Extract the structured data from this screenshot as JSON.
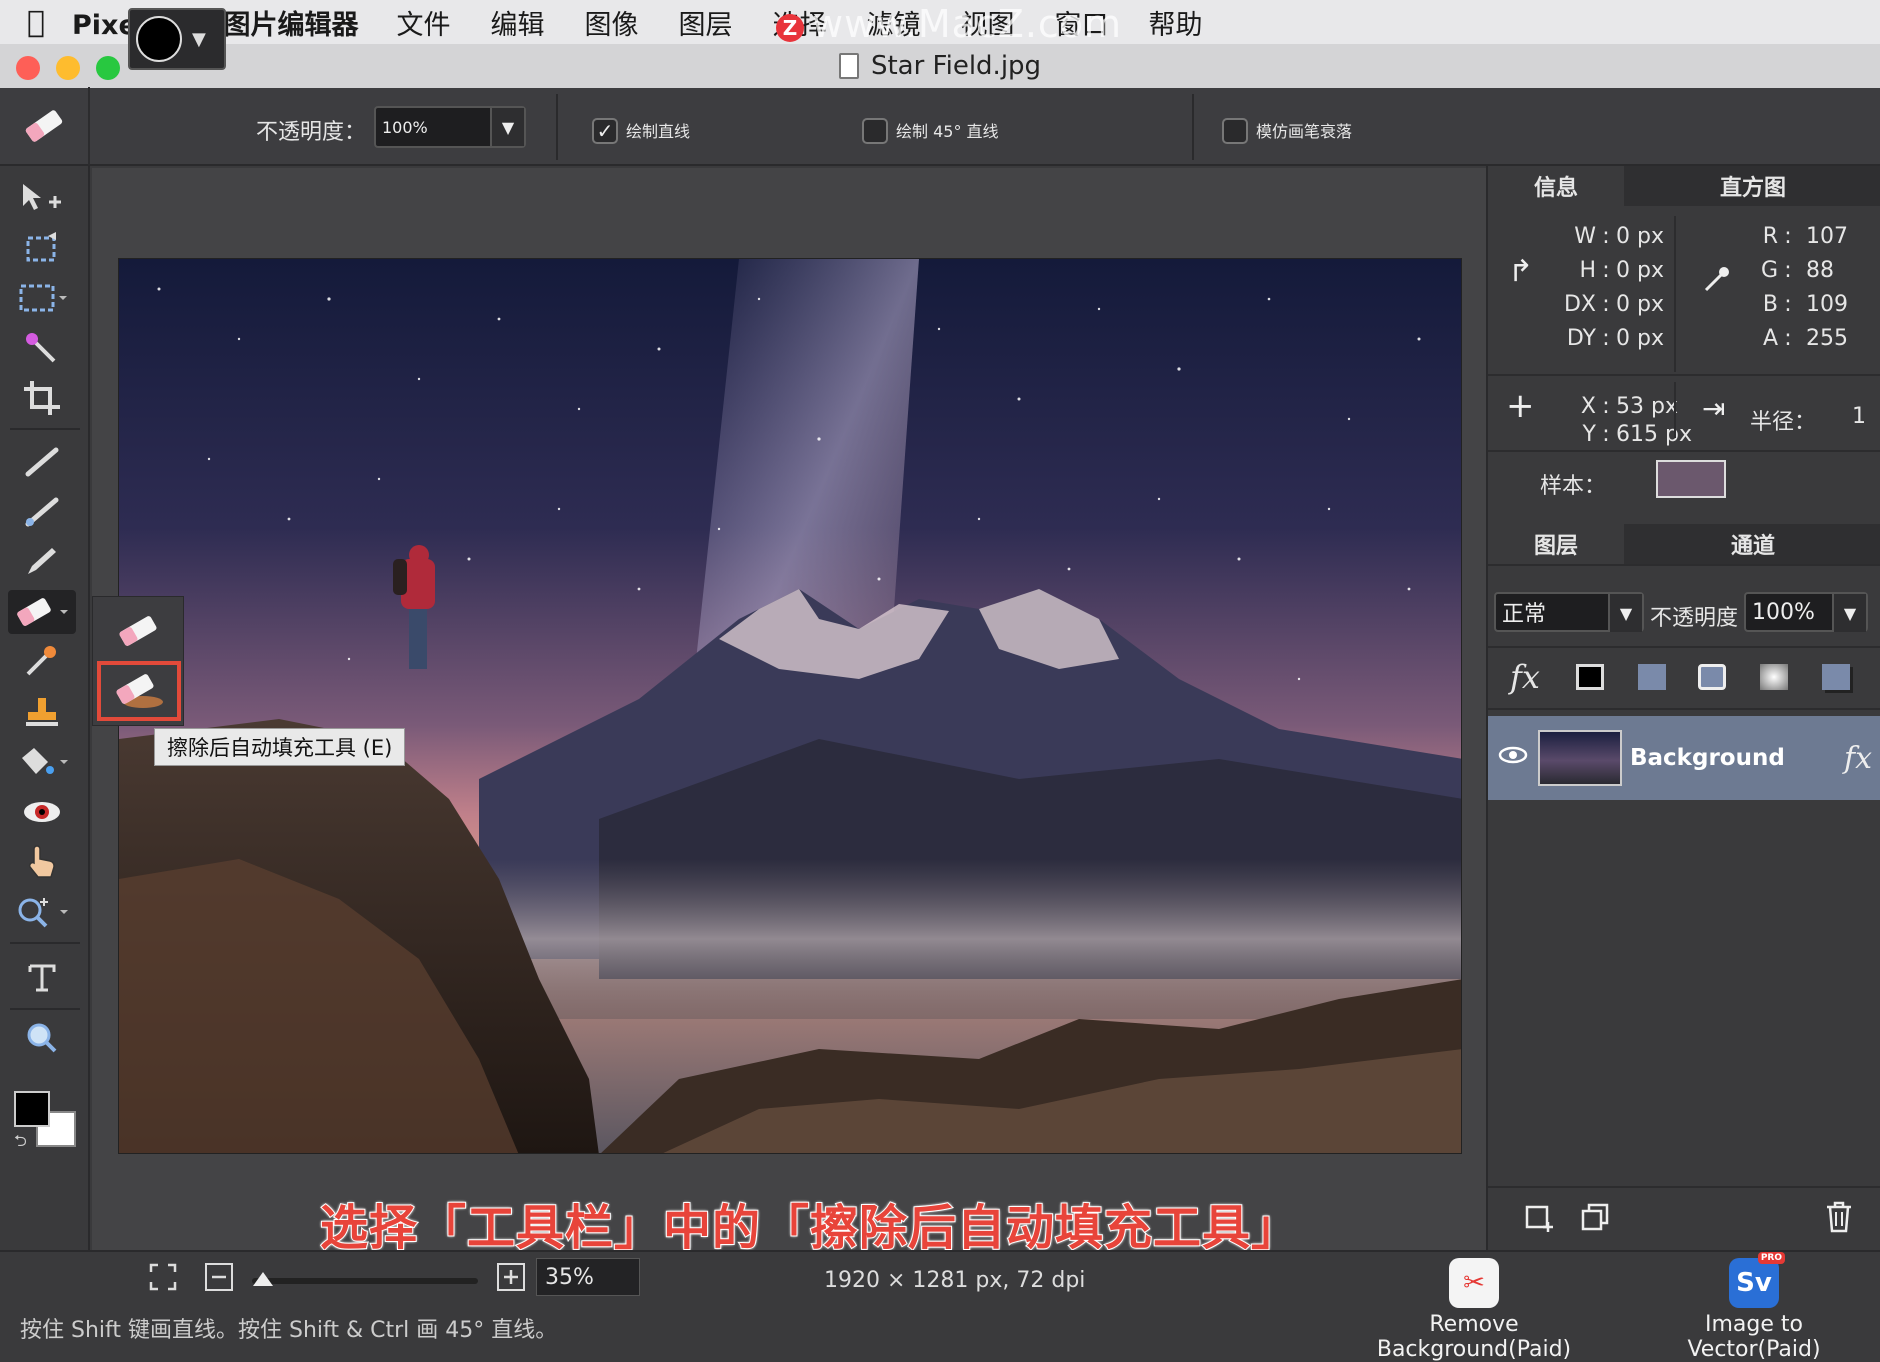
{
  "menubar": {
    "app_name": "PixelStyle图片编辑器",
    "items": [
      "文件",
      "编辑",
      "图像",
      "图层",
      "选择",
      "滤镜",
      "视图",
      "窗口",
      "帮助"
    ],
    "watermark": "www.MacZ.com",
    "watermark_badge": "Z"
  },
  "window": {
    "title": "Star Field.jpg"
  },
  "options": {
    "opacity_label": "不透明度：",
    "opacity_value": "100%",
    "draw_line_label": "绘制直线",
    "draw_line_checked": true,
    "draw_45_label": "绘制 45° 直线",
    "draw_45_checked": false,
    "fade_label": "模仿画笔衰落",
    "fade_checked": false
  },
  "toolbar": {
    "icons": [
      "move-tool",
      "transform-tool",
      "marquee-tool",
      "magic-wand-tool",
      "crop-tool",
      "brush-tool",
      "smudge-tool",
      "pencil-tool",
      "eraser-tool",
      "eyedropper-tool",
      "stamp-tool",
      "fill-tool",
      "red-eye-tool",
      "hand-tool",
      "zoom-tool",
      "text-tool",
      "magnifier-tool"
    ]
  },
  "flyout": {
    "tooltip": "擦除后自动填充工具 (E)"
  },
  "caption": "选择「工具栏」中的「擦除后自动填充工具」",
  "info_panel": {
    "tabs": [
      "信息",
      "直方图"
    ],
    "size": [
      {
        "k": "W",
        "v": "0 px"
      },
      {
        "k": "H",
        "v": "0 px"
      },
      {
        "k": "DX",
        "v": "0 px"
      },
      {
        "k": "DY",
        "v": "0 px"
      }
    ],
    "color": [
      {
        "k": "R",
        "v": "107"
      },
      {
        "k": "G",
        "v": "88"
      },
      {
        "k": "B",
        "v": "109"
      },
      {
        "k": "A",
        "v": "255"
      }
    ],
    "pos": [
      {
        "k": "X",
        "v": "53 px"
      },
      {
        "k": "Y",
        "v": "615 px"
      }
    ],
    "radius_label": "半径：",
    "radius_value": "1",
    "sample_label": "样本：",
    "sample_color": "#6b586d"
  },
  "layers_panel": {
    "tabs": [
      "图层",
      "通道"
    ],
    "blend_mode": "正常",
    "opacity_label": "不透明度",
    "opacity_value": "100%",
    "fx": "fx",
    "layer_name": "Background"
  },
  "status": {
    "zoom": "35%",
    "dims": "1920 × 1281 px, 72 dpi",
    "hint": "按住 Shift 键画直线。按住 Shift & Ctrl 画 45° 直线。",
    "zoom_level": 0.05,
    "promo1": "Remove Background(Paid)",
    "promo2": "Image to Vector(Paid)",
    "promo2_icon": "Sv",
    "promo2_badge": "PRO"
  },
  "colors": {
    "accent_red": "#e24a3a",
    "caption_red": "#e8443a",
    "layer_selected": "#6d7a92"
  }
}
